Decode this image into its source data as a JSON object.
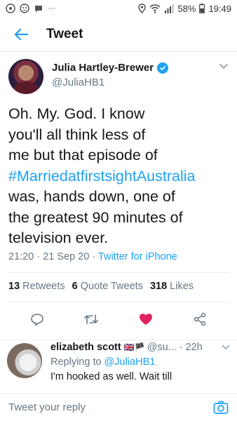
{
  "status_bar": {
    "battery": "58%",
    "time": "19:49",
    "more": "···"
  },
  "header": {
    "title": "Tweet"
  },
  "tweet": {
    "author_name": "Julia Hartley-Brewer",
    "author_handle": "@JuliaHB1",
    "text_lines": [
      "Oh. My. God. I know",
      "you'll all think less of",
      "me but that episode of",
      "#MarriedatfirstsightAustralia",
      "was, hands down, one of",
      "the greatest 90 minutes of",
      "television ever."
    ],
    "timestamp": "21:20 · 21 Sep 20 · ",
    "source": "Twitter for iPhone",
    "retweets_count": "13",
    "retweets_label": "Retweets",
    "quotes_count": "6",
    "quotes_label": "Quote Tweets",
    "likes_count": "318",
    "likes_label": "Likes"
  },
  "reply": {
    "author_name": "elizabeth scott",
    "flags": "🇬🇧🏴",
    "handle": "@su...",
    "time": "· 22h",
    "replying_to_label": "Replying to ",
    "replying_to_handle": "@JuliaHB1",
    "text": "I'm hooked as well. Wait till"
  },
  "compose": {
    "placeholder": "Tweet your reply"
  },
  "colors": {
    "accent": "#1da1f2",
    "like": "#e0245e",
    "secondary_text": "#657786"
  }
}
